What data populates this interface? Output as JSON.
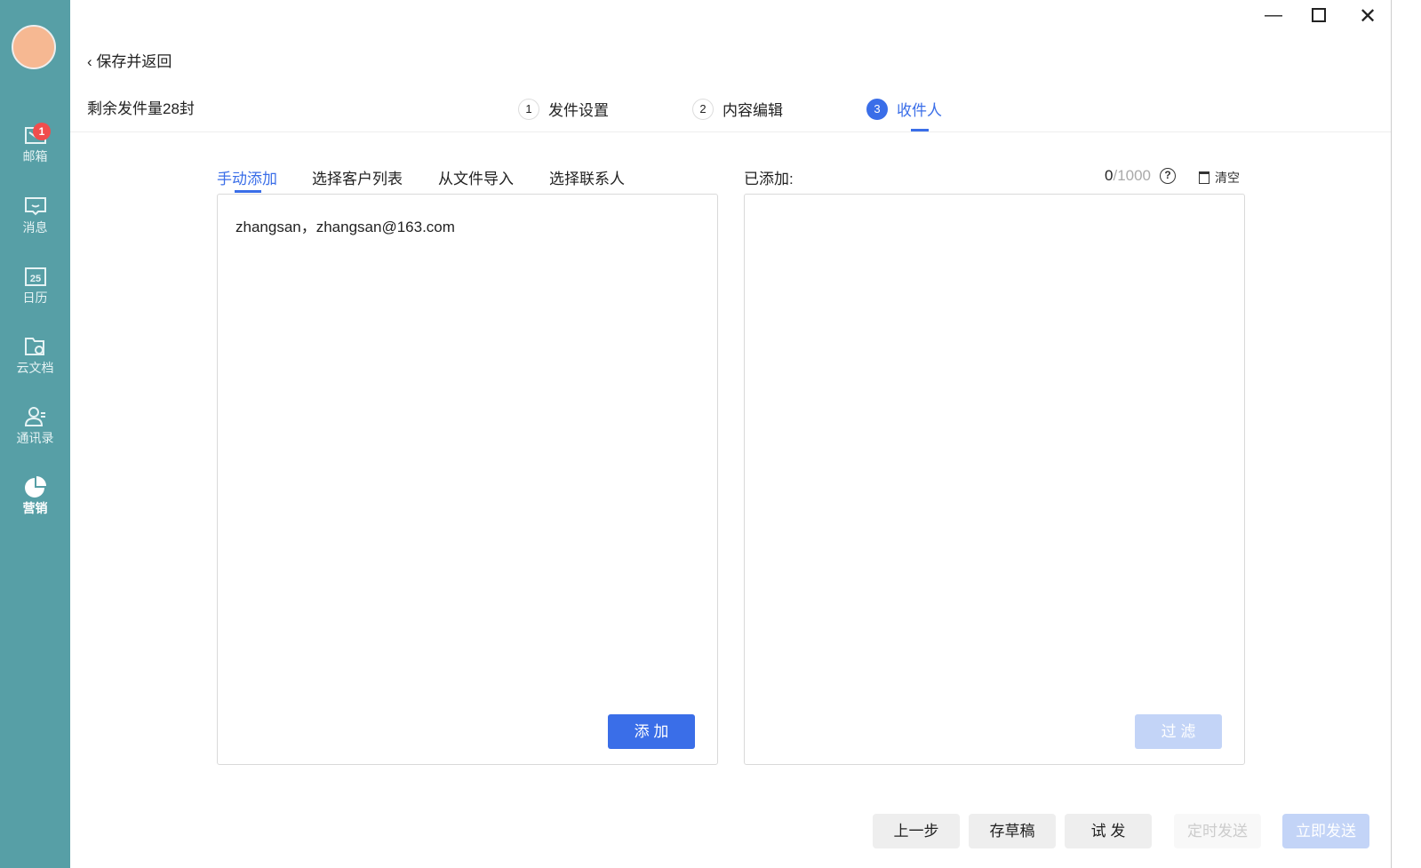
{
  "sidebar": {
    "items": [
      {
        "label": "邮箱",
        "badge": "1"
      },
      {
        "label": "消息"
      },
      {
        "label": "日历",
        "day": "25"
      },
      {
        "label": "云文档"
      },
      {
        "label": "通讯录"
      },
      {
        "label": "营销"
      }
    ]
  },
  "header": {
    "back": "保存并返回",
    "quota": "剩余发件量28封"
  },
  "steps": [
    {
      "num": "1",
      "label": "发件设置"
    },
    {
      "num": "2",
      "label": "内容编辑"
    },
    {
      "num": "3",
      "label": "收件人"
    }
  ],
  "tabs": [
    "手动添加",
    "选择客户列表",
    "从文件导入",
    "选择联系人"
  ],
  "input": {
    "value": "zhangsan，zhangsan@163.com"
  },
  "add_button": "添 加",
  "added": {
    "label": "已添加:",
    "count": "0",
    "limit": "/1000",
    "clear": "清空",
    "filter": "过 滤"
  },
  "footer": {
    "prev": "上一步",
    "draft": "存草稿",
    "test": "试 发",
    "schedule": "定时发送",
    "send": "立即发送"
  },
  "colors": {
    "accent": "#3a6ee8",
    "sidebar": "#579fa6"
  }
}
